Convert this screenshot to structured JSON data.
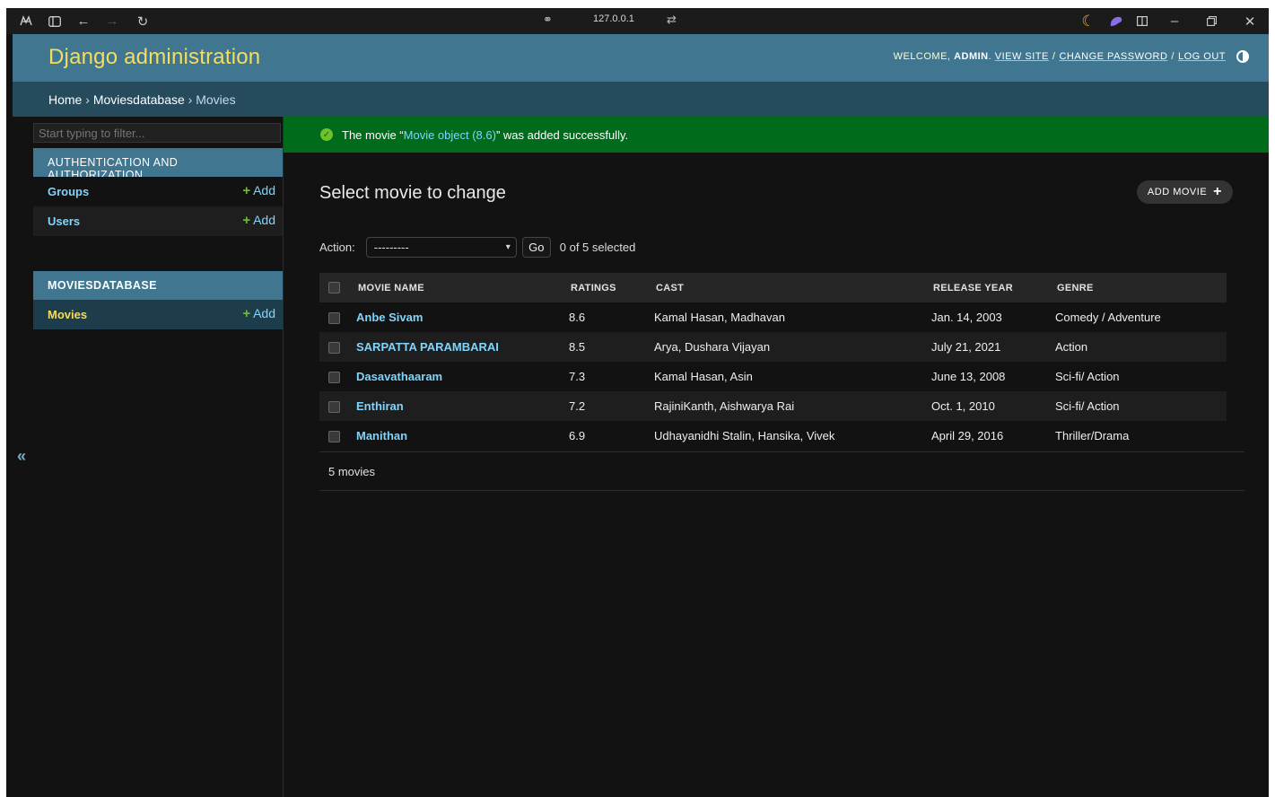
{
  "browser": {
    "url": "127.0.0.1"
  },
  "header": {
    "branding": "Django administration",
    "welcome": "WELCOME,",
    "username": "ADMIN",
    "view_site": "VIEW SITE",
    "change_password": "CHANGE PASSWORD",
    "log_out": "LOG OUT",
    "separator": "/"
  },
  "breadcrumbs": {
    "home": "Home",
    "app": "Moviesdatabase",
    "current": "Movies",
    "sep": "›"
  },
  "sidebar": {
    "filter_placeholder": "Start typing to filter...",
    "auth_caption": "AUTHENTICATION AND AUTHORIZATION",
    "auth_items": [
      {
        "name": "Groups",
        "add": "Add"
      },
      {
        "name": "Users",
        "add": "Add"
      }
    ],
    "movies_caption": "MOVIESDATABASE",
    "movies_items": [
      {
        "name": "Movies",
        "add": "Add"
      }
    ],
    "collapse": "«"
  },
  "message": {
    "prefix": "The movie “",
    "link": "Movie object (8.6)",
    "suffix": "” was added successfully."
  },
  "content": {
    "title": "Select movie to change",
    "add_button": "ADD MOVIE",
    "action_label": "Action:",
    "action_value": "---------",
    "go": "Go",
    "selected": "0 of 5 selected",
    "footer": "5 movies"
  },
  "table": {
    "headers": [
      "MOVIE NAME",
      "RATINGS",
      "CAST",
      "RELEASE YEAR",
      "GENRE"
    ],
    "rows": [
      {
        "name": "Anbe Sivam",
        "rating": "8.6",
        "cast": "Kamal Hasan, Madhavan",
        "release": "Jan. 14, 2003",
        "genre": "Comedy / Adventure"
      },
      {
        "name": "SARPATTA PARAMBARAI",
        "rating": "8.5",
        "cast": "Arya, Dushara Vijayan",
        "release": "July 21, 2021",
        "genre": "Action"
      },
      {
        "name": "Dasavathaaram",
        "rating": "7.3",
        "cast": "Kamal Hasan, Asin",
        "release": "June 13, 2008",
        "genre": "Sci-fi/ Action"
      },
      {
        "name": "Enthiran",
        "rating": "7.2",
        "cast": "RajiniKanth, Aishwarya Rai",
        "release": "Oct. 1, 2010",
        "genre": "Sci-fi/ Action"
      },
      {
        "name": "Manithan",
        "rating": "6.9",
        "cast": "Udhayanidhi Stalin, Hansika, Vivek",
        "release": "April 29, 2016",
        "genre": "Thriller/Drama"
      }
    ]
  },
  "colors": {
    "header_bg": "#417690",
    "breadcrumb_bg": "#264b5d",
    "branding": "#f5dd5d",
    "link": "#81d4fa",
    "success_bg": "#006b1b",
    "add_green": "#70bf2b"
  }
}
